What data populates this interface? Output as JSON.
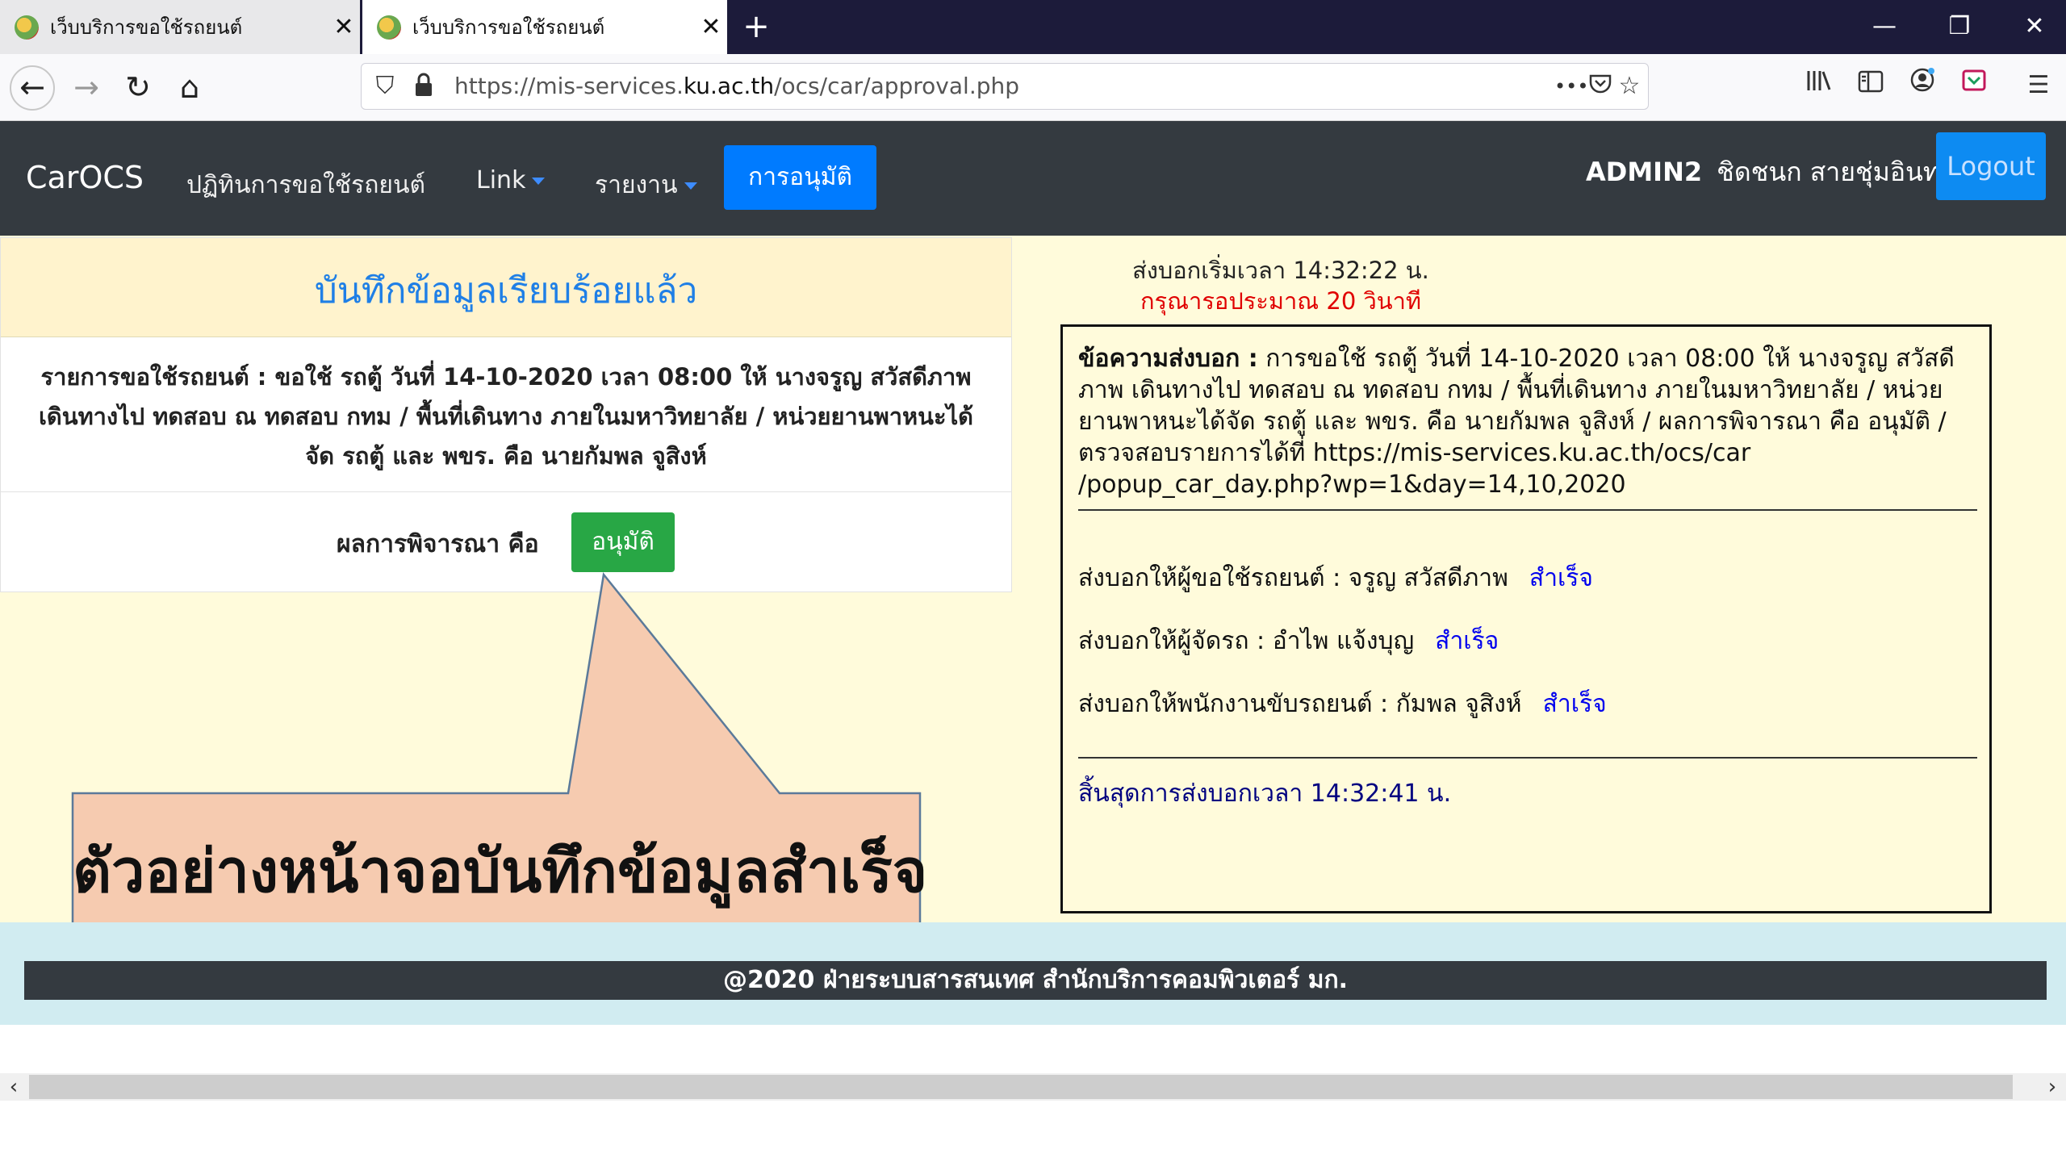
{
  "browser": {
    "tabs": [
      {
        "title": "เว็บบริการขอใช้รถยนต์",
        "active": false
      },
      {
        "title": "เว็บบริการขอใช้รถยนต์",
        "active": true
      }
    ],
    "new_tab": "+",
    "close_glyph": "✕",
    "window_controls": {
      "minimize": "—",
      "restore": "❐",
      "close": "✕"
    },
    "url_prefix": "https://mis-services.",
    "url_domain": "ku.ac.th",
    "url_path": "/ocs/car/approval.php",
    "url_more": "•••"
  },
  "app": {
    "brand": "CarOCS",
    "menu": {
      "calendar": "ปฏิทินการขอใช้รถยนต์",
      "link": "Link",
      "report": "รายงาน",
      "approve": "การอนุมัติ"
    },
    "user_name": "ADMIN2",
    "user_fullname": "ชิดชนก สายชุ่มอินทร์",
    "logout": "Logout"
  },
  "result_card": {
    "success_title": "บันทึกข้อมูลเรียบร้อยแล้ว",
    "details": "รายการขอใช้รถยนต์ : ขอใช้ รถตู้ วันที่ 14-10-2020 เวลา 08:00 ให้ นางจรูญ สวัสดีภาพ เดินทางไป ทดสอบ ณ ทดสอบ กทม / พื้นที่เดินทาง ภายในมหาวิทยาลัย / หน่วยยานพาหนะได้จัด รถตู้ และ พขร. คือ นายกัมพล จูสิงห์",
    "result_label": "ผลการพิจารณา คือ",
    "result_value": "อนุมัติ"
  },
  "notify": {
    "start": "ส่งบอกเริ่มเวลา 14:32:22 น.",
    "wait": "กรุณารอประมาณ 20 วินาที",
    "message_label": "ข้อความส่งบอก :",
    "message_body": " การขอใช้ รถตู้ วันที่ 14-10-2020 เวลา 08:00 ให้ นางจรูญ สวัสดีภาพ เดินทางไป ทดสอบ ณ ทดสอบ กทม / พื้นที่เดินทาง ภายในมหาวิทยาลัย / หน่วยยานพาหนะได้จัด รถตู้ และ พขร. คือ นายกัมพล จูสิงห์ / ผลการพิจารณา คือ อนุมัติ / ตรวจสอบรายการได้ที่ https://mis-services.ku.ac.th/ocs/car /popup_car_day.php?wp=1&day=14,10,2020",
    "requester": "ส่งบอกให้ผู้ขอใช้รถยนต์ : จรูญ สวัสดีภาพ",
    "dispatcher": "ส่งบอกให้ผู้จัดรถ : อำไพ แจ้งบุญ",
    "driver": "ส่งบอกให้พนักงานขับรถยนต์ : กัมพล จูสิงห์",
    "status_ok": "สำเร็จ",
    "end": "สิ้นสุดการส่งบอกเวลา 14:32:41 น."
  },
  "callout": "ตัวอย่างหน้าจอบันทึกข้อมูลสำเร็จ",
  "footer": "@2020 ฝ่ายระบบสารสนเทศ สำนักบริการคอมพิวเตอร์ มก.",
  "colors": {
    "primary": "#007bff",
    "success": "#28a745",
    "header_dark": "#343a40",
    "alert_bg": "#fff3cd",
    "page_bg": "#fffbdb",
    "callout_fill": "#f6cbb0",
    "callout_stroke": "#5b7a9a"
  },
  "icons": [
    "back-arrow-icon",
    "forward-arrow-icon",
    "reload-icon",
    "home-icon",
    "shield-icon",
    "lock-icon",
    "more-icon",
    "pocket-icon",
    "star-icon",
    "library-icon",
    "sidebar-icon",
    "account-icon",
    "extension-icon",
    "hamburger-menu-icon",
    "caret-down-icon"
  ]
}
